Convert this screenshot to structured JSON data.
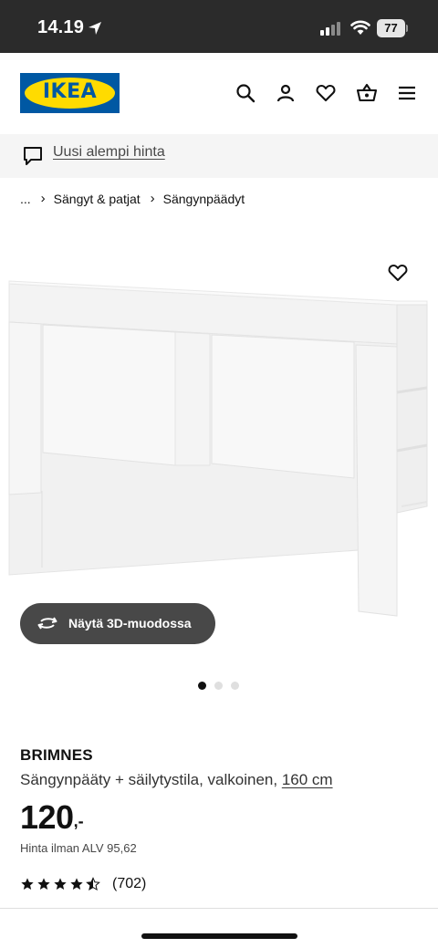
{
  "status_bar": {
    "time": "14.19",
    "battery": "77"
  },
  "header": {
    "logo_text": "IKEA",
    "icons": [
      "search-icon",
      "user-icon",
      "heart-icon",
      "basket-icon",
      "menu-icon"
    ]
  },
  "notice": {
    "text": "Uusi alempi hinta"
  },
  "breadcrumb": {
    "items": [
      "...",
      "Sängyt & patjat",
      "Sängynpäädyt"
    ]
  },
  "gallery": {
    "view_3d_label": "Näytä 3D-muodossa",
    "dot_count": 3,
    "active_index": 0
  },
  "product": {
    "brand": "BRIMNES",
    "description": "Sängynpääty + säilytystila, valkoinen,",
    "size": "160 cm",
    "price_integer": "120",
    "price_suffix": ",-",
    "vat_text": "Hinta ilman ALV 95,62",
    "rating_value": 4.5,
    "rating_count": "(702)"
  },
  "colors": {
    "brand_blue": "#0058a3",
    "brand_yellow": "#ffdb00",
    "text": "#111111",
    "button_dark": "#484848"
  }
}
